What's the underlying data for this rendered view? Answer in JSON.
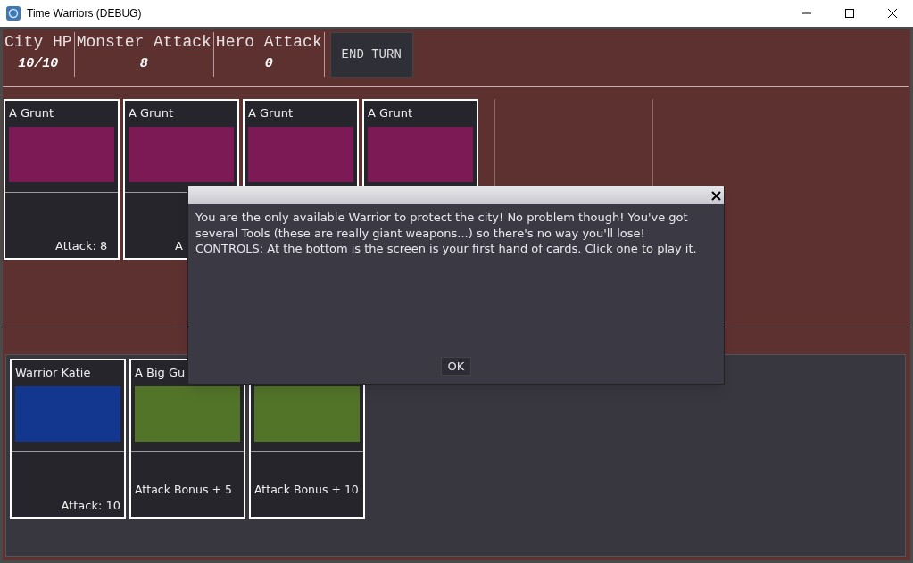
{
  "window": {
    "title": "Time Warriors (DEBUG)"
  },
  "stats": [
    {
      "label": "City HP",
      "value": "10/10"
    },
    {
      "label": "Monster Attack",
      "value": "8"
    },
    {
      "label": "Hero Attack",
      "value": "0"
    }
  ],
  "end_turn_button": "END TURN",
  "monster_cards": [
    {
      "kind": "monster",
      "title": "A Grunt",
      "color": "#7b1a54",
      "footer": "Attack: 8"
    },
    {
      "kind": "monster",
      "title": "A Grunt",
      "color": "#7b1a54",
      "footer": "A"
    },
    {
      "kind": "monster",
      "title": "A Grunt",
      "color": "#7b1a54"
    },
    {
      "kind": "monster",
      "title": "A Grunt",
      "color": "#7b1a54"
    }
  ],
  "hand_cards": [
    {
      "kind": "warrior",
      "title": "Warrior Katie",
      "color": "#13368f",
      "footer": "Attack: 10"
    },
    {
      "kind": "tool",
      "title": "A Big Gu",
      "color": "#527428",
      "footer": "Attack Bonus + 5"
    },
    {
      "kind": "tool",
      "color": "#527428",
      "footer": "Attack Bonus + 10"
    }
  ],
  "dialog": {
    "message": "You are the only available Warrior to protect the city! No problem though! You've got several Tools (these are really giant weapons...) so there's no way you'll lose! CONTROLS: At the bottom is the screen is your first hand of cards. Click one to play it.",
    "ok_button": "OK"
  }
}
